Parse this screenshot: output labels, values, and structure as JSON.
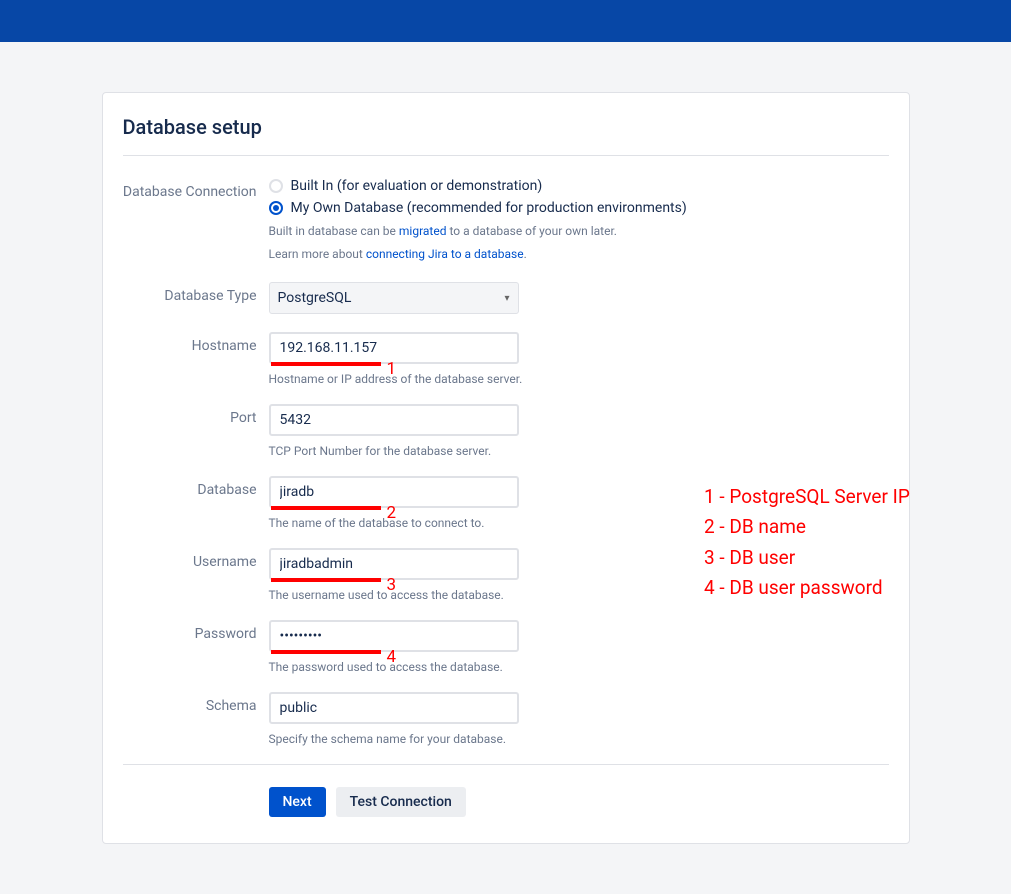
{
  "title": "Database setup",
  "fields": {
    "connection": {
      "label": "Database Connection",
      "option_builtin": "Built In (for evaluation or demonstration)",
      "option_own": "My Own Database (recommended for production environments)",
      "hint_prefix": "Built in database can be ",
      "hint_link1": "migrated",
      "hint_mid": " to a database of your own later.",
      "hint2_prefix": "Learn more about ",
      "hint2_link": "connecting Jira to a database",
      "hint2_suffix": "."
    },
    "dbtype": {
      "label": "Database Type",
      "value": "PostgreSQL"
    },
    "hostname": {
      "label": "Hostname",
      "value": "192.168.11.157",
      "desc": "Hostname or IP address of the database server.",
      "marker": "1"
    },
    "port": {
      "label": "Port",
      "value": "5432",
      "desc": "TCP Port Number for the database server."
    },
    "database": {
      "label": "Database",
      "value": "jiradb",
      "desc": "The name of the database to connect to.",
      "marker": "2"
    },
    "username": {
      "label": "Username",
      "value": "jiradbadmin",
      "desc": "The username used to access the database.",
      "marker": "3"
    },
    "password": {
      "label": "Password",
      "value": "•••••••••",
      "desc": "The password used to access the database.",
      "marker": "4"
    },
    "schema": {
      "label": "Schema",
      "value": "public",
      "desc": "Specify the schema name for your database."
    }
  },
  "buttons": {
    "next": "Next",
    "test": "Test Connection"
  },
  "legend": {
    "l1": "1 - PostgreSQL Server IP",
    "l2": "2 - DB name",
    "l3": "3 - DB user",
    "l4": "4 - DB user password"
  }
}
